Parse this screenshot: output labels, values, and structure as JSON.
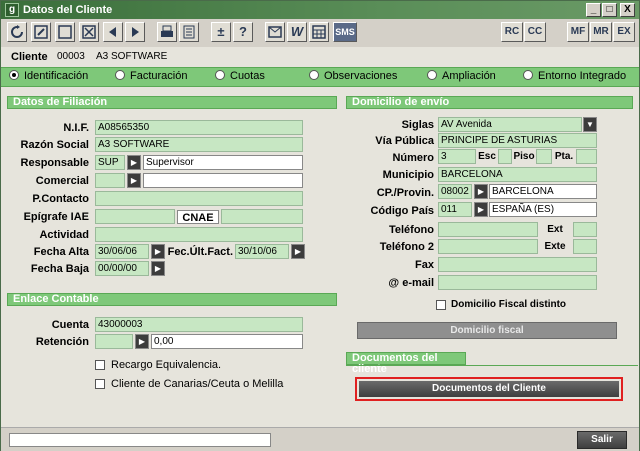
{
  "window": {
    "title": "Datos del Cliente",
    "icon_letter": "g",
    "controls": {
      "minimize": "_",
      "maximize": "□",
      "close": "X"
    }
  },
  "toolbar": {
    "left_icons": [
      "refresh-icon",
      "edit-icon",
      "new-icon",
      "delete-icon",
      "prev-icon",
      "next-icon",
      "print-icon",
      "list-icon",
      "plusminus-icon",
      "help-icon",
      "mail-icon",
      "word-icon",
      "calc-icon",
      "sms-icon"
    ],
    "glyphs": {
      "plusminus": "±",
      "help": "?",
      "word": "W",
      "sms": "SMS"
    },
    "right_buttons": [
      "RC",
      "CC",
      "MF",
      "MR",
      "EX"
    ]
  },
  "client": {
    "label": "Cliente",
    "code": "00003",
    "name": "A3 SOFTWARE"
  },
  "tabs": [
    {
      "label": "Identificación",
      "selected": true
    },
    {
      "label": "Facturación",
      "selected": false
    },
    {
      "label": "Cuotas",
      "selected": false
    },
    {
      "label": "Observaciones",
      "selected": false
    },
    {
      "label": "Ampliación",
      "selected": false
    },
    {
      "label": "Entorno Integrado",
      "selected": false
    }
  ],
  "filiacion": {
    "title": "Datos de Filiación",
    "nif": {
      "label": "N.I.F.",
      "value": "A08565350"
    },
    "razon": {
      "label": "Razón Social",
      "value": "A3 SOFTWARE"
    },
    "responsable": {
      "label": "Responsable",
      "code": "SUP",
      "name": "Supervisor"
    },
    "comercial": {
      "label": "Comercial",
      "code": "",
      "name": ""
    },
    "contacto": {
      "label": "P.Contacto",
      "value": ""
    },
    "epigrafe": {
      "label": "Epígrafe  IAE",
      "value": "",
      "cnae_label": "CNAE",
      "cnae": ""
    },
    "actividad": {
      "label": "Actividad",
      "value": ""
    },
    "fecha_alta": {
      "label": "Fecha Alta",
      "value": "30/06/06"
    },
    "fec_ult": {
      "label": "Fec.Últ.Fact.",
      "value": "30/10/06"
    },
    "fecha_baja": {
      "label": "Fecha Baja",
      "value": "00/00/00"
    }
  },
  "enlace": {
    "title": "Enlace Contable",
    "cuenta": {
      "label": "Cuenta",
      "value": "43000003"
    },
    "retencion": {
      "label": "Retención",
      "value": "0,00"
    },
    "recargo": {
      "label": "Recargo Equivalencia.",
      "checked": false
    },
    "canarias": {
      "label": "Cliente de Canarias/Ceuta o Melilla",
      "checked": false
    }
  },
  "domicilio": {
    "title": "Domicilio de envío",
    "siglas": {
      "label": "Siglas",
      "value": "AV Avenida"
    },
    "via": {
      "label": "Vía Pública",
      "value": "PRINCIPE DE ASTURIAS"
    },
    "numero": {
      "label": "Número",
      "value": "3",
      "esc_label": "Esc",
      "esc": "",
      "piso_label": "Piso",
      "piso": "",
      "pta_label": "Pta.",
      "pta": ""
    },
    "municipio": {
      "label": "Municipio",
      "value": "BARCELONA"
    },
    "cp": {
      "label": "CP./Provin.",
      "code": "08002",
      "name": "BARCELONA"
    },
    "pais": {
      "label": "Código País",
      "code": "011",
      "name": "ESPAÑA (ES)"
    },
    "telefono": {
      "label": "Teléfono",
      "value": "",
      "ext_label": "Ext",
      "ext": ""
    },
    "telefono2": {
      "label": "Teléfono 2",
      "value": "",
      "ext_label": "Exte",
      "ext": ""
    },
    "fax": {
      "label": "Fax",
      "value": ""
    },
    "email": {
      "label": "@ e-mail",
      "value": ""
    },
    "fiscal_check": {
      "label": "Domicilio Fiscal distinto",
      "checked": false
    },
    "fiscal_button": "Domicilio fiscal"
  },
  "documentos": {
    "title": "Documentos del cliente",
    "button": "Documentos del Cliente"
  },
  "footer": {
    "status_text": "",
    "exit": "Salir"
  },
  "colors": {
    "accent_green": "#7ec879",
    "field_green": "#c7e7c3",
    "highlight_red": "#e02020"
  }
}
